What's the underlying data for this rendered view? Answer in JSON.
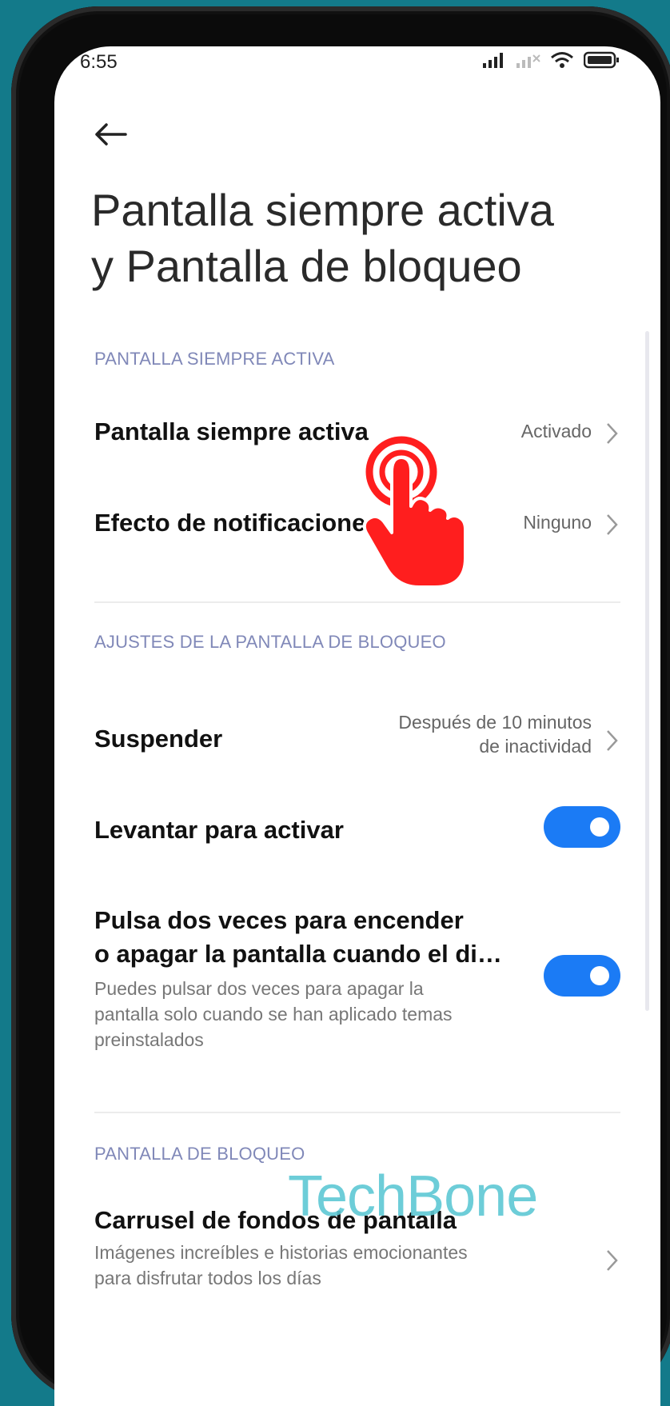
{
  "status": {
    "time": "6:55"
  },
  "page": {
    "title_line1": "Pantalla siempre activa",
    "title_line2": "y Pantalla de bloqueo"
  },
  "sections": {
    "always_on": {
      "header": "PANTALLA SIEMPRE ACTIVA",
      "rows": [
        {
          "title": "Pantalla siempre activa",
          "value": "Activado"
        },
        {
          "title": "Efecto de notificaciones",
          "value": "Ninguno"
        }
      ]
    },
    "lock_settings": {
      "header": "AJUSTES DE LA PANTALLA DE BLOQUEO",
      "suspend": {
        "title": "Suspender",
        "value_line1": "Después de 10 minutos",
        "value_line2": "de inactividad"
      },
      "raise": {
        "title": "Levantar para activar",
        "enabled": true
      },
      "double_tap": {
        "title_line1": "Pulsa dos veces para encender",
        "title_line2": "o apagar la pantalla cuando el di…",
        "sub_line1": "Puedes pulsar dos veces para apagar la",
        "sub_line2": "pantalla solo cuando se han aplicado temas",
        "sub_line3": "preinstalados",
        "enabled": true
      }
    },
    "lock_screen": {
      "header": "PANTALLA DE BLOQUEO",
      "carousel": {
        "title": "Carrusel de fondos de pantalla",
        "sub_line1": "Imágenes increíbles e historias emocionantes",
        "sub_line2": "para disfrutar todos los días"
      }
    }
  },
  "watermark": "TechBone",
  "colors": {
    "accent": "#1b7bf5",
    "section_header": "#8088b8",
    "background": "#137a8a",
    "tap_indicator": "#ff1e1e"
  }
}
